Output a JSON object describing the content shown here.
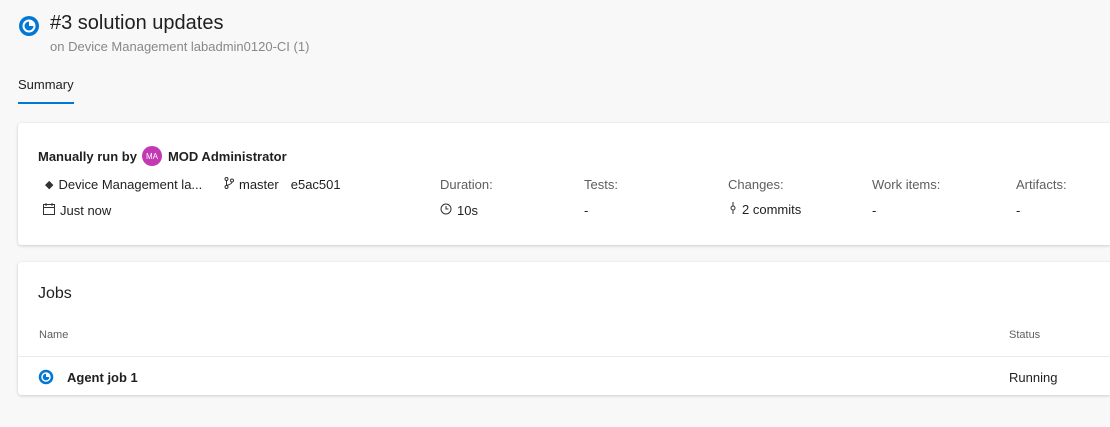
{
  "header": {
    "title": "#3 solution updates",
    "subtitle": "on Device Management labadmin0120-CI (1)"
  },
  "tabs": [
    {
      "label": "Summary",
      "selected": true
    }
  ],
  "summary": {
    "manual_label": "Manually run by",
    "avatar_initials": "MA",
    "user": "MOD Administrator",
    "repo": "Device Management la...",
    "branch": "master",
    "commit": "e5ac501",
    "time": "Just now",
    "duration_label": "Duration:",
    "duration_value": "10s",
    "tests_label": "Tests:",
    "tests_value": "-",
    "changes_label": "Changes:",
    "changes_value": "2 commits",
    "workitems_label": "Work items:",
    "workitems_value": "-",
    "artifacts_label": "Artifacts:",
    "artifacts_value": "-"
  },
  "jobs": {
    "title": "Jobs",
    "col_name": "Name",
    "col_status": "Status",
    "rows": [
      {
        "name": "Agent job 1",
        "status": "Running"
      }
    ]
  },
  "colors": {
    "accent": "#0078d4",
    "avatar": "#c239b3"
  }
}
